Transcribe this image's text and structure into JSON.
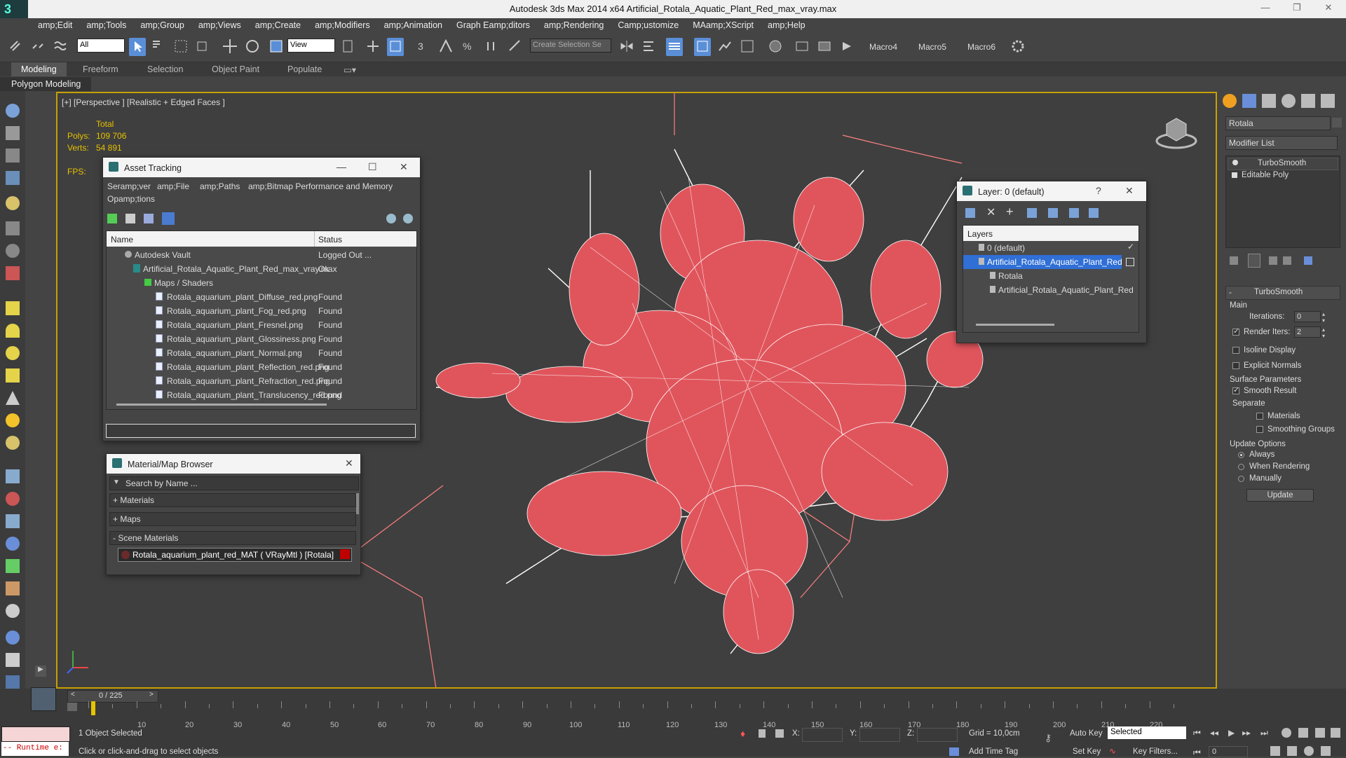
{
  "app": {
    "title": "Autodesk 3ds Max  2014 x64     Artificial_Rotala_Aquatic_Plant_Red_max_vray.max"
  },
  "menu": [
    "amp;Edit",
    "amp;Tools",
    "amp;Group",
    "amp;Views",
    "amp;Create",
    "amp;Modifiers",
    "amp;Animation",
    "Graph Eamp;ditors",
    "amp;Rendering",
    "Camp;ustomize",
    "MAamp;XScript",
    "amp;Help"
  ],
  "toolbar": {
    "filter": "All",
    "ref_coord": "View",
    "selection_set_placeholder": "Create Selection Se",
    "macros": [
      "Macro4",
      "Macro5",
      "Macro6"
    ]
  },
  "ribbon": {
    "tabs": [
      "Modeling",
      "Freeform",
      "Selection",
      "Object Paint",
      "Populate"
    ],
    "panel": "Polygon Modeling"
  },
  "viewport": {
    "label": "[+] [Perspective ] [Realistic + Edged Faces ]",
    "stats_header": "Total",
    "polys_label": "Polys:",
    "polys_value": "109 706",
    "verts_label": "Verts:",
    "verts_value": "54 891",
    "fps_label": "FPS:"
  },
  "asset_tracking": {
    "title": "Asset Tracking",
    "menu": [
      "Seramp;ver",
      "amp;File",
      "amp;Paths",
      "amp;Bitmap Performance and Memory",
      "Opamp;tions"
    ],
    "col_name": "Name",
    "col_status": "Status",
    "rows": [
      {
        "name": "Autodesk Vault",
        "status": "Logged Out ..."
      },
      {
        "name": "Artificial_Rotala_Aquatic_Plant_Red_max_vray.max",
        "status": "Ok"
      },
      {
        "name": "Maps / Shaders",
        "status": ""
      },
      {
        "name": "Rotala_aquarium_plant_Diffuse_red.png",
        "status": "Found"
      },
      {
        "name": "Rotala_aquarium_plant_Fog_red.png",
        "status": "Found"
      },
      {
        "name": "Rotala_aquarium_plant_Fresnel.png",
        "status": "Found"
      },
      {
        "name": "Rotala_aquarium_plant_Glossiness.png",
        "status": "Found"
      },
      {
        "name": "Rotala_aquarium_plant_Normal.png",
        "status": "Found"
      },
      {
        "name": "Rotala_aquarium_plant_Reflection_red.png",
        "status": "Found"
      },
      {
        "name": "Rotala_aquarium_plant_Refraction_red.png",
        "status": "Found"
      },
      {
        "name": "Rotala_aquarium_plant_Translucency_red.png",
        "status": "Found"
      }
    ]
  },
  "material_browser": {
    "title": "Material/Map Browser",
    "search_placeholder": "Search by Name ...",
    "sections": [
      "+ Materials",
      "+ Maps",
      "- Scene Materials"
    ],
    "material": "Rotala_aquarium_plant_red_MAT  ( VRayMtl )  [Rotala]",
    "material_color": "#c00000"
  },
  "layer_window": {
    "title": "Layer: 0 (default)",
    "help": "?",
    "header": "Layers",
    "items": [
      "0 (default)",
      "Artificial_Rotala_Aquatic_Plant_Red",
      "Rotala",
      "Artificial_Rotala_Aquatic_Plant_Red"
    ]
  },
  "command_panel": {
    "object_name": "Rotala",
    "modifier_list": "Modifier List",
    "stack": [
      "TurboSmooth",
      "Editable Poly"
    ],
    "rollout_title": "TurboSmooth",
    "main_label": "Main",
    "iterations_label": "Iterations:",
    "iterations_value": "0",
    "render_iters_label": "Render Iters:",
    "render_iters_value": "2",
    "isoline_label": "Isoline Display",
    "explicit_normals_label": "Explicit Normals",
    "surface_params_label": "Surface Parameters",
    "smooth_result_label": "Smooth Result",
    "separate_label": "Separate",
    "materials_label": "Materials",
    "smoothing_groups_label": "Smoothing Groups",
    "update_options_label": "Update Options",
    "always_label": "Always",
    "when_rendering_label": "When Rendering",
    "manually_label": "Manually",
    "update_button": "Update"
  },
  "timeline": {
    "frame_counter": "0 / 225",
    "ticks": [
      "10",
      "20",
      "30",
      "40",
      "50",
      "60",
      "70",
      "80",
      "90",
      "100",
      "110",
      "120",
      "130",
      "140",
      "150",
      "160",
      "170",
      "180",
      "190",
      "200",
      "210",
      "220"
    ]
  },
  "status": {
    "maxscript": "-- Runtime e:",
    "selected": "1 Object Selected",
    "prompt": "Click or click-and-drag to select objects",
    "x_label": "X:",
    "y_label": "Y:",
    "z_label": "Z:",
    "grid": "Grid = 10,0cm",
    "add_time_tag": "Add Time Tag",
    "auto_key": "Auto Key",
    "set_key": "Set Key",
    "selected_dropdown": "Selected",
    "key_filters": "Key Filters...",
    "frame_value": "0"
  }
}
